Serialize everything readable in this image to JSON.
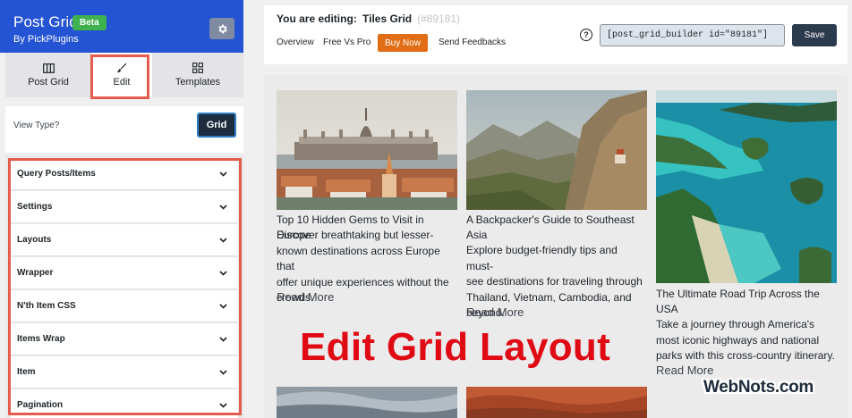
{
  "brand": {
    "title": "Post Grid",
    "badge": "Beta",
    "subtitle": "By PickPlugins"
  },
  "tabs": [
    {
      "label": "Post Grid",
      "icon": "columns-icon"
    },
    {
      "label": "Edit",
      "icon": "brush-icon"
    },
    {
      "label": "Templates",
      "icon": "grid-icon"
    }
  ],
  "view_type": {
    "label": "View Type?",
    "button": "Grid"
  },
  "panels": [
    {
      "label": "Query Posts/Items"
    },
    {
      "label": "Settings"
    },
    {
      "label": "Layouts"
    },
    {
      "label": "Wrapper"
    },
    {
      "label": "N'th Item CSS"
    },
    {
      "label": "Items Wrap"
    },
    {
      "label": "Item"
    },
    {
      "label": "Pagination"
    }
  ],
  "topbar": {
    "editing_label": "You are editing:",
    "editing_name": "Tiles Grid",
    "editing_id": "(#89181)",
    "nav": {
      "overview": "Overview",
      "free_vs_pro": "Free Vs Pro",
      "buy_now": "Buy Now",
      "send_feedbacks": "Send Feedbacks"
    },
    "help": "?",
    "shortcode": "[post_grid_builder id=\"89181\"]",
    "save": "Save"
  },
  "cards": [
    {
      "title_lines": [
        "Top 10 Hidden Gems to Visit in Europe"
      ],
      "excerpt_lines": [
        "Discover breathtaking but lesser-",
        "known destinations across Europe that",
        "offer unique experiences without the",
        "crowds."
      ],
      "read_more": "Read More"
    },
    {
      "title_lines": [
        "A Backpacker's Guide to Southeast",
        "Asia"
      ],
      "excerpt_lines": [
        "Explore budget-friendly tips and must-",
        "see destinations for traveling through",
        "Thailand, Vietnam, Cambodia, and",
        "beyond."
      ],
      "read_more": "Read More"
    },
    {
      "title_lines": [
        "The Ultimate Road Trip Across the",
        "USA"
      ],
      "excerpt_lines": [
        "Take a journey through America's",
        "most iconic highways and national",
        "parks with this cross-country itinerary."
      ],
      "read_more": "Read More"
    }
  ],
  "overlay_title": "Edit Grid Layout",
  "watermark": "WebNots.com",
  "colors": {
    "brand_blue": "#2453d4",
    "beta_green": "#3fb24f",
    "buy_orange": "#e16d14",
    "highlight_red": "#e45c4d",
    "overlay_red": "#e00a14"
  }
}
